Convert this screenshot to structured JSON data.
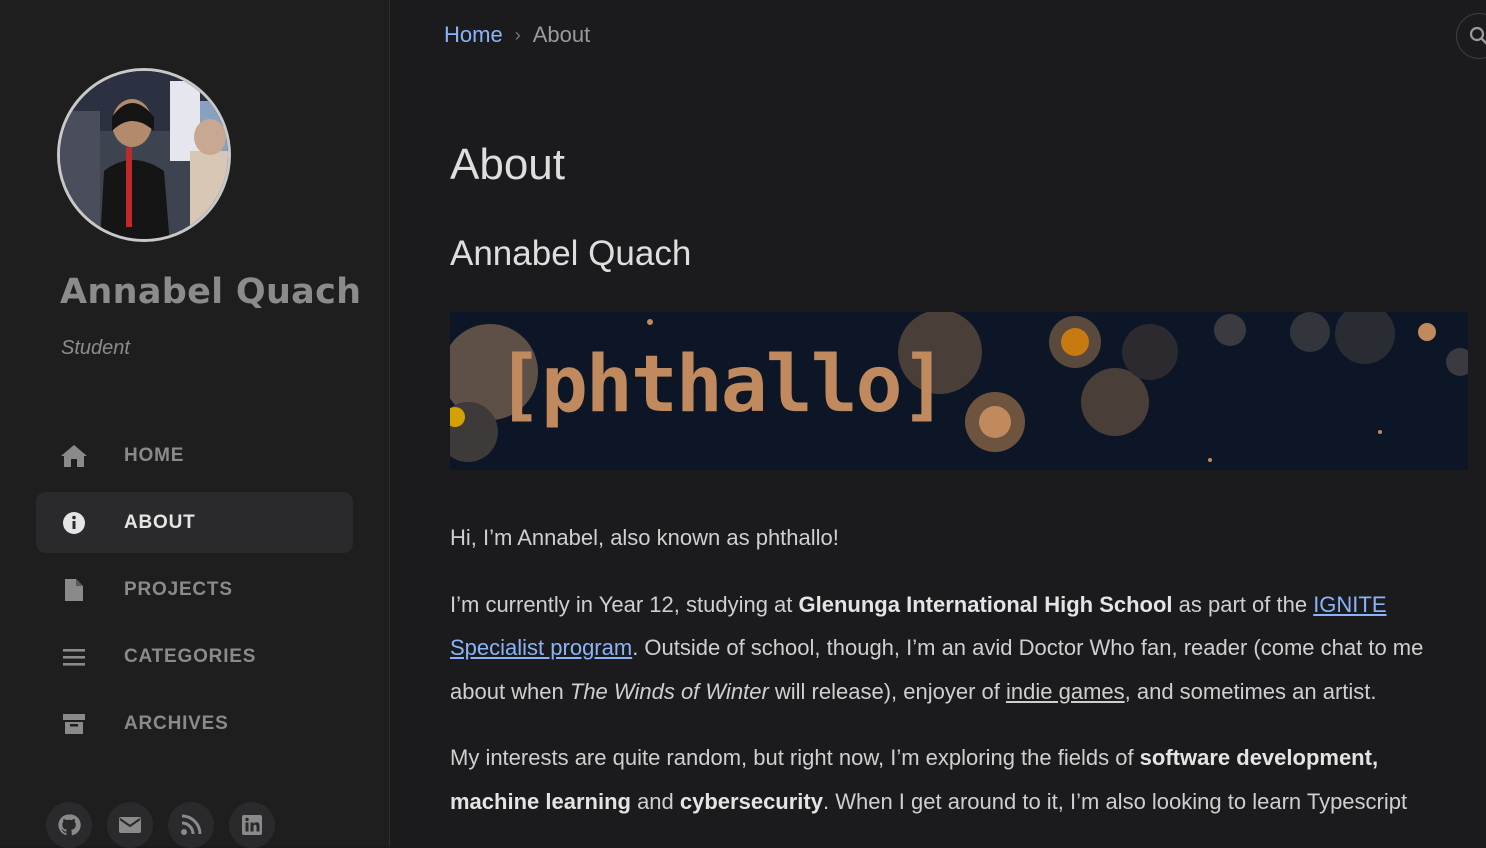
{
  "sidebar": {
    "title": "Annabel Quach",
    "subtitle": "Student",
    "nav": [
      {
        "label": "HOME",
        "icon": "home-icon"
      },
      {
        "label": "ABOUT",
        "icon": "info-icon",
        "active": true
      },
      {
        "label": "PROJECTS",
        "icon": "file-icon"
      },
      {
        "label": "CATEGORIES",
        "icon": "list-icon"
      },
      {
        "label": "ARCHIVES",
        "icon": "archive-icon"
      }
    ],
    "socials": [
      "github-icon",
      "email-icon",
      "rss-icon",
      "linkedin-icon"
    ]
  },
  "breadcrumb": {
    "home": "Home",
    "separator": "›",
    "current": "About"
  },
  "main": {
    "page_title": "About",
    "section_title": "Annabel Quach",
    "banner_text": "[phthallo]",
    "p1": "Hi, I’m Annabel, also known as phthallo!",
    "p2": {
      "t1": "I’m currently in Year 12, studying at ",
      "school": "Glenunga International High School",
      "t2": " as part of the ",
      "program_link": "IGNITE Specialist program",
      "t3": ". Outside of school, though, I’m an avid Doctor Who fan, reader (come chat to me about when ",
      "book": "The Winds of Winter",
      "t4": " will release), enjoyer of ",
      "games_link": "indie games",
      "t5": ", and sometimes an artist."
    },
    "p3": {
      "t1": "My interests are quite random, but right now, I’m exploring the fields of ",
      "b1": "software development, machine learning",
      "t2": " and ",
      "b2": "cybersecurity",
      "t3": ". When I get around to it, I’m also looking to learn Typescript"
    }
  },
  "colors": {
    "background": "#1b1b1e",
    "sidebar": "#1e1e1e",
    "link": "#8ab4f8",
    "banner_text": "#c18a5e"
  }
}
